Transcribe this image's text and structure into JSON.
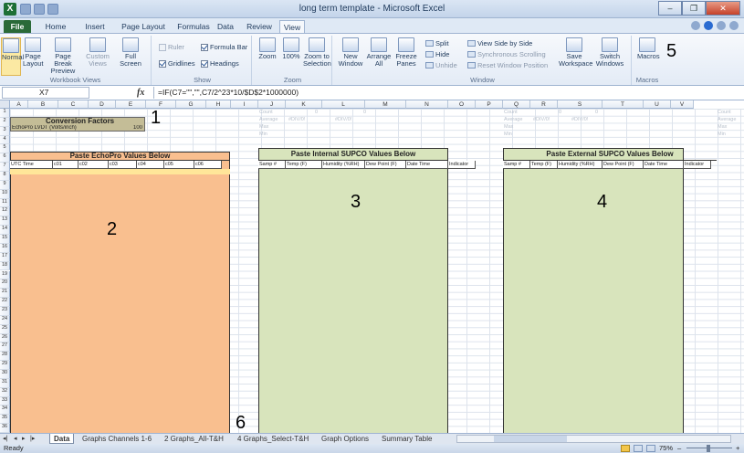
{
  "window": {
    "title": "long term template - Microsoft Excel",
    "minimize": "–",
    "restore": "❐",
    "close": "✕"
  },
  "tabs": [
    "File",
    "Home",
    "Insert",
    "Page Layout",
    "Formulas",
    "Data",
    "Review",
    "View"
  ],
  "ribbon": {
    "workbook_views": {
      "label": "Workbook Views",
      "normal": "Normal",
      "page_layout": "Page Layout",
      "page_break": "Page Break Preview",
      "custom": "Custom Views",
      "full": "Full Screen"
    },
    "show": {
      "label": "Show",
      "ruler": "Ruler",
      "formula_bar": "Formula Bar",
      "gridlines": "Gridlines",
      "headings": "Headings"
    },
    "zoom": {
      "label": "Zoom",
      "zoom": "Zoom",
      "hundred": "100%",
      "to_selection": "Zoom to Selection"
    },
    "window": {
      "label": "Window",
      "new_window": "New Window",
      "arrange": "Arrange All",
      "freeze": "Freeze Panes",
      "split": "Split",
      "hide": "Hide",
      "unhide": "Unhide",
      "side_by_side": "View Side by Side",
      "sync_scroll": "Synchronous Scrolling",
      "reset_pos": "Reset Window Position",
      "save_ws": "Save Workspace",
      "switch": "Switch Windows"
    },
    "macros": {
      "label": "Macros",
      "macros": "Macros"
    }
  },
  "formula_bar": {
    "cell": "X7",
    "fx": "fx",
    "formula": "=IF(C7=\"\",\"\",C7/2^23*10/$D$2*1000000)"
  },
  "columns": [
    "A",
    "B",
    "C",
    "D",
    "E",
    "F",
    "G",
    "H",
    "I",
    "J",
    "K",
    "L",
    "M",
    "N",
    "O",
    "P",
    "Q",
    "R",
    "S",
    "T",
    "U",
    "V"
  ],
  "rows": [
    "1",
    "2",
    "3",
    "4",
    "5",
    "6",
    "7",
    "8",
    "9",
    "10",
    "11",
    "12",
    "13",
    "14",
    "15",
    "16",
    "17",
    "18",
    "19",
    "20",
    "21",
    "22",
    "23",
    "24",
    "25",
    "26",
    "27",
    "28",
    "29",
    "30",
    "31",
    "32",
    "33",
    "34",
    "35",
    "36"
  ],
  "conversion": {
    "title": "Conversion Factors",
    "label": "EchoPro LVDT (Volts/inch)",
    "value": "100"
  },
  "echopro": {
    "title": "Paste EchoPro Values Below",
    "headers": [
      "UTC Time",
      "c01",
      "c02",
      "c03",
      "c04",
      "c05",
      "c06"
    ]
  },
  "internal": {
    "title": "Paste Internal SUPCO Values Below",
    "headers": [
      "Samp #",
      "Temp (F)",
      "Humidity (%RH)",
      "Dew Point (F)",
      "Date Time",
      "Indicator"
    ]
  },
  "external": {
    "title": "Paste External SUPCO Values Below",
    "headers": [
      "Samp #",
      "Temp (F)",
      "Humidity (%RH)",
      "Dew Point (F)",
      "Date Time",
      "Indicator"
    ]
  },
  "stats": {
    "labels": [
      "Count",
      "Average",
      "Max",
      "Min"
    ],
    "zero": "0",
    "div": "#DIV/0!"
  },
  "callouts": [
    "1",
    "2",
    "3",
    "4",
    "5",
    "6"
  ],
  "sheet_tabs": [
    "Data",
    "Graphs Channels 1-6",
    "2 Graphs_All-T&H",
    "4 Graphs_Select-T&H",
    "Graph Options",
    "Summary Table"
  ],
  "status": {
    "ready": "Ready",
    "zoom": "75%",
    "minus": "–",
    "plus": "+"
  },
  "colors": {
    "echopro_fill": "#f9bf8f",
    "supco_fill": "#d8e4bc",
    "conversion_fill": "#c4bd97"
  }
}
